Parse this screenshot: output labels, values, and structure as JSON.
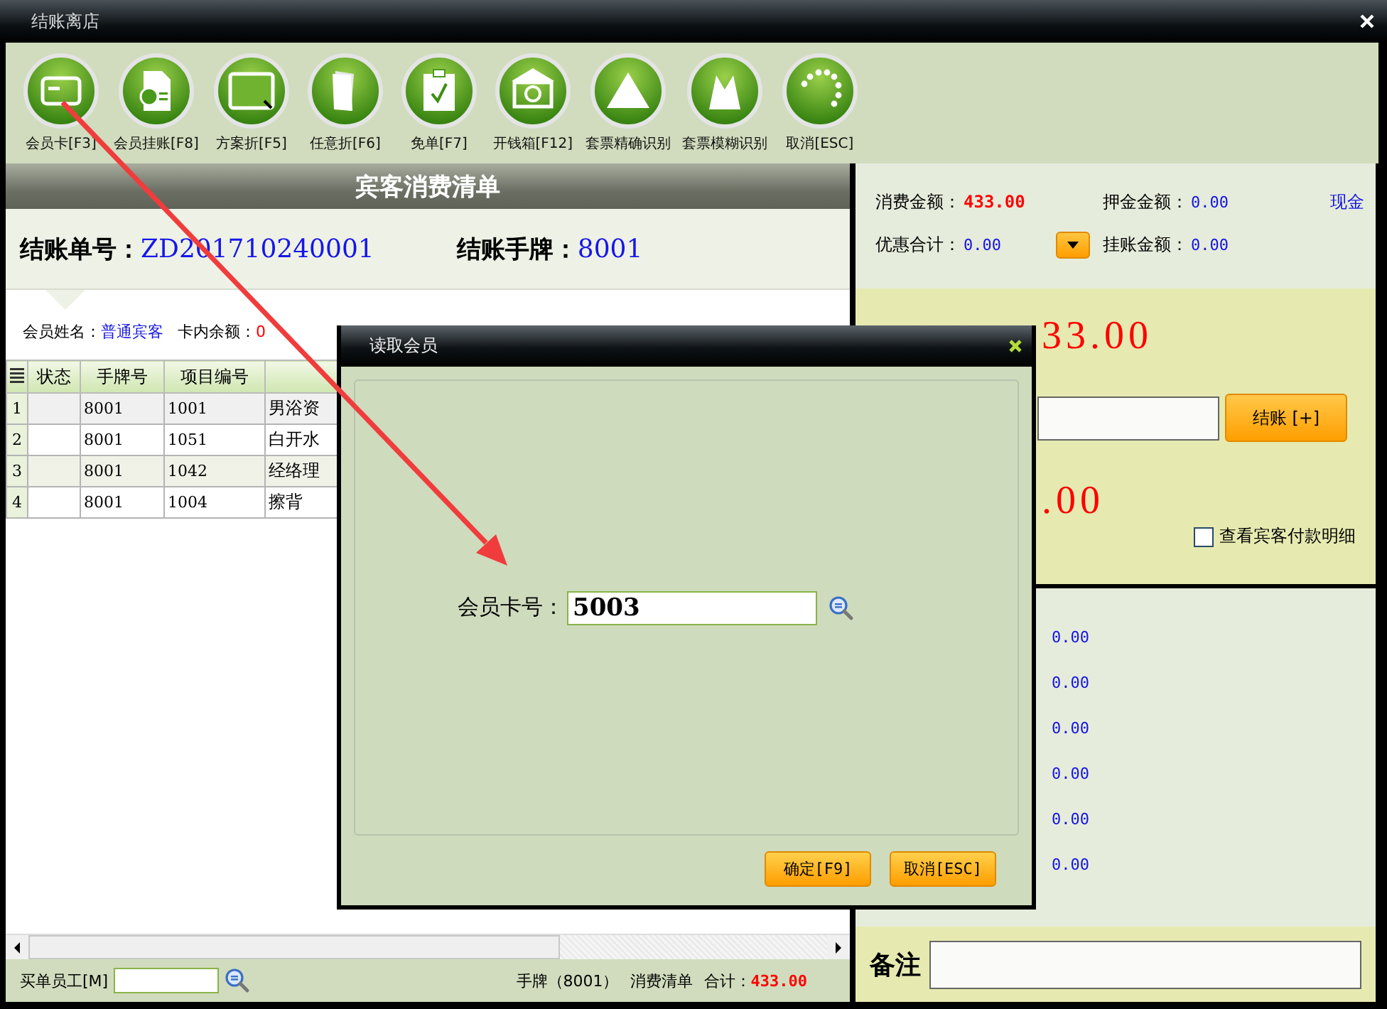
{
  "window": {
    "title": "结账离店"
  },
  "toolbar": [
    {
      "label": "会员卡[F3]"
    },
    {
      "label": "会员挂账[F8]"
    },
    {
      "label": "方案折[F5]"
    },
    {
      "label": "任意折[F6]"
    },
    {
      "label": "免单[F7]"
    },
    {
      "label": "开钱箱[F12]"
    },
    {
      "label": "套票精确识别"
    },
    {
      "label": "套票模糊识别"
    },
    {
      "label": "取消[ESC]"
    }
  ],
  "bill": {
    "title": "宾客消费清单",
    "order_label": "结账单号：",
    "order_no": "ZD201710240001",
    "tag_label": "结账手牌：",
    "tag_no": "8001",
    "member_label": "会员姓名：",
    "member_name": "普通宾客",
    "balance_label": "卡内余额：",
    "balance": "0"
  },
  "table": {
    "columns": [
      "状态",
      "手牌号",
      "项目编号"
    ],
    "rows": [
      {
        "index": "1",
        "hand_no": "8001",
        "item_no": "1001",
        "item": "男浴资"
      },
      {
        "index": "2",
        "hand_no": "8001",
        "item_no": "1051",
        "item": "白开水"
      },
      {
        "index": "3",
        "hand_no": "8001",
        "item_no": "1042",
        "item": "经络理"
      },
      {
        "index": "4",
        "hand_no": "8001",
        "item_no": "1004",
        "item": "擦背"
      }
    ]
  },
  "footer": {
    "staff_label": "买单员工[M]",
    "summary_tag": "手牌（8001）",
    "summary_list": "消费清单",
    "total_label": "合计：",
    "total": "433.00"
  },
  "summary": {
    "spend_label": "消费金额：",
    "spend": "433.00",
    "deposit_label": "押金金额：",
    "deposit": "0.00",
    "cash_link": "现金",
    "discount_label": "优惠合计：",
    "discount": "0.00",
    "credit_label": "挂账金额：",
    "credit": "0.00",
    "due": "33.00",
    "checkout_button": "结账 [+]",
    "change": ".00",
    "detail_checkbox": {
      "label": "查看宾客付款明细",
      "checked": false
    },
    "amounts": [
      "0.00",
      "0.00",
      "0.00",
      "0.00",
      "0.00",
      "0.00"
    ],
    "remark_label": "备注"
  },
  "dialog": {
    "title": "读取会员",
    "card_label": "会员卡号：",
    "card_value": "5003",
    "buttons": [
      "确定[F9]",
      "取消[ESC]"
    ]
  }
}
